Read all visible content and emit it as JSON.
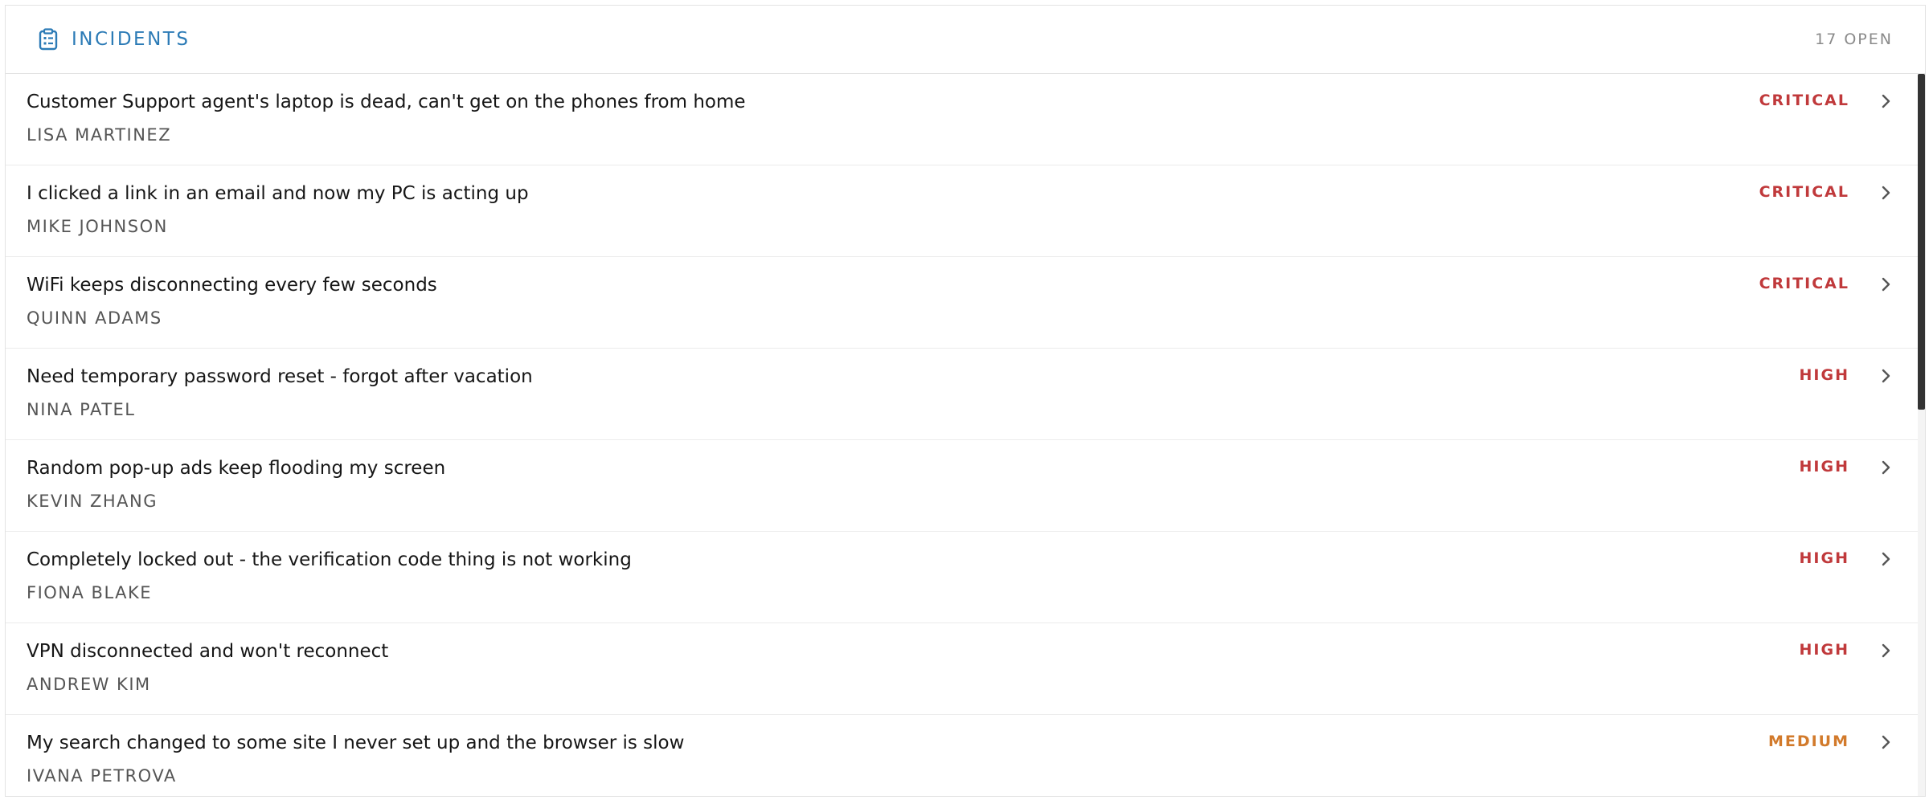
{
  "header": {
    "title": "INCIDENTS",
    "open_count": "17 OPEN",
    "accent_color": "#2c7bb6",
    "icon": "clipboard-list-icon"
  },
  "priority_colors": {
    "CRITICAL": "#c0393b",
    "HIGH": "#c0393b",
    "MEDIUM": "#d27a2b"
  },
  "incidents": [
    {
      "title": "Customer Support agent's laptop is dead, can't get on the phones from home",
      "reporter": "LISA MARTINEZ",
      "priority": "CRITICAL"
    },
    {
      "title": "I clicked a link in an email and now my PC is acting up",
      "reporter": "MIKE JOHNSON",
      "priority": "CRITICAL"
    },
    {
      "title": "WiFi keeps disconnecting every few seconds",
      "reporter": "QUINN ADAMS",
      "priority": "CRITICAL"
    },
    {
      "title": "Need temporary password reset - forgot after vacation",
      "reporter": "NINA PATEL",
      "priority": "HIGH"
    },
    {
      "title": "Random pop-up ads keep flooding my screen",
      "reporter": "KEVIN ZHANG",
      "priority": "HIGH"
    },
    {
      "title": "Completely locked out - the verification code thing is not working",
      "reporter": "FIONA BLAKE",
      "priority": "HIGH"
    },
    {
      "title": "VPN disconnected and won't reconnect",
      "reporter": "ANDREW KIM",
      "priority": "HIGH"
    },
    {
      "title": "My search changed to some site I never set up and the browser is slow",
      "reporter": "IVANA PETROVA",
      "priority": "MEDIUM"
    }
  ]
}
